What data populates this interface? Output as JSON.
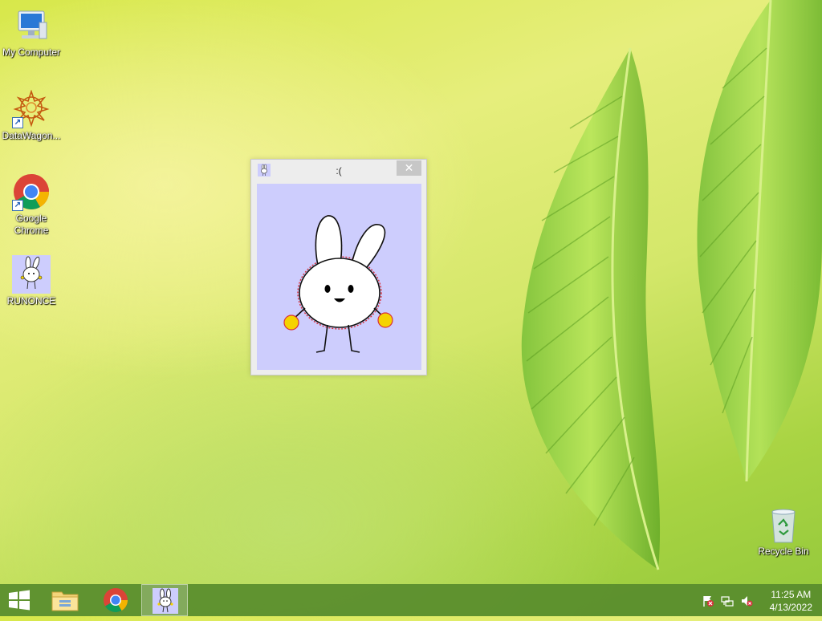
{
  "desktop": {
    "icons": [
      {
        "label": "My Computer",
        "icon": "computer-icon"
      },
      {
        "label": "DataWagon...",
        "icon": "datawagon-icon"
      },
      {
        "label_line1": "Google",
        "label_line2": "Chrome",
        "icon": "chrome-icon"
      },
      {
        "label": "RUNONCE",
        "icon": "bunny-icon"
      }
    ],
    "recycle_bin": {
      "label": "Recycle Bin",
      "icon": "recycle-bin-icon"
    }
  },
  "window": {
    "title": ":(",
    "close_glyph": "✕",
    "client_bg": "#cdcdfd",
    "content_icon": "bunny-icon"
  },
  "taskbar": {
    "pinned": [
      {
        "name": "start",
        "icon": "windows-logo-icon"
      },
      {
        "name": "file-explorer",
        "icon": "folder-icon"
      },
      {
        "name": "chrome",
        "icon": "chrome-icon"
      },
      {
        "name": "runonce",
        "icon": "bunny-icon",
        "active": true
      }
    ],
    "tray": [
      "action-center-flag-icon",
      "network-icon",
      "volume-muted-icon"
    ],
    "clock": {
      "time": "11:25 AM",
      "date": "4/13/2022"
    }
  },
  "colors": {
    "taskbar": "#588c2d",
    "accent": "#cdcdfd"
  }
}
